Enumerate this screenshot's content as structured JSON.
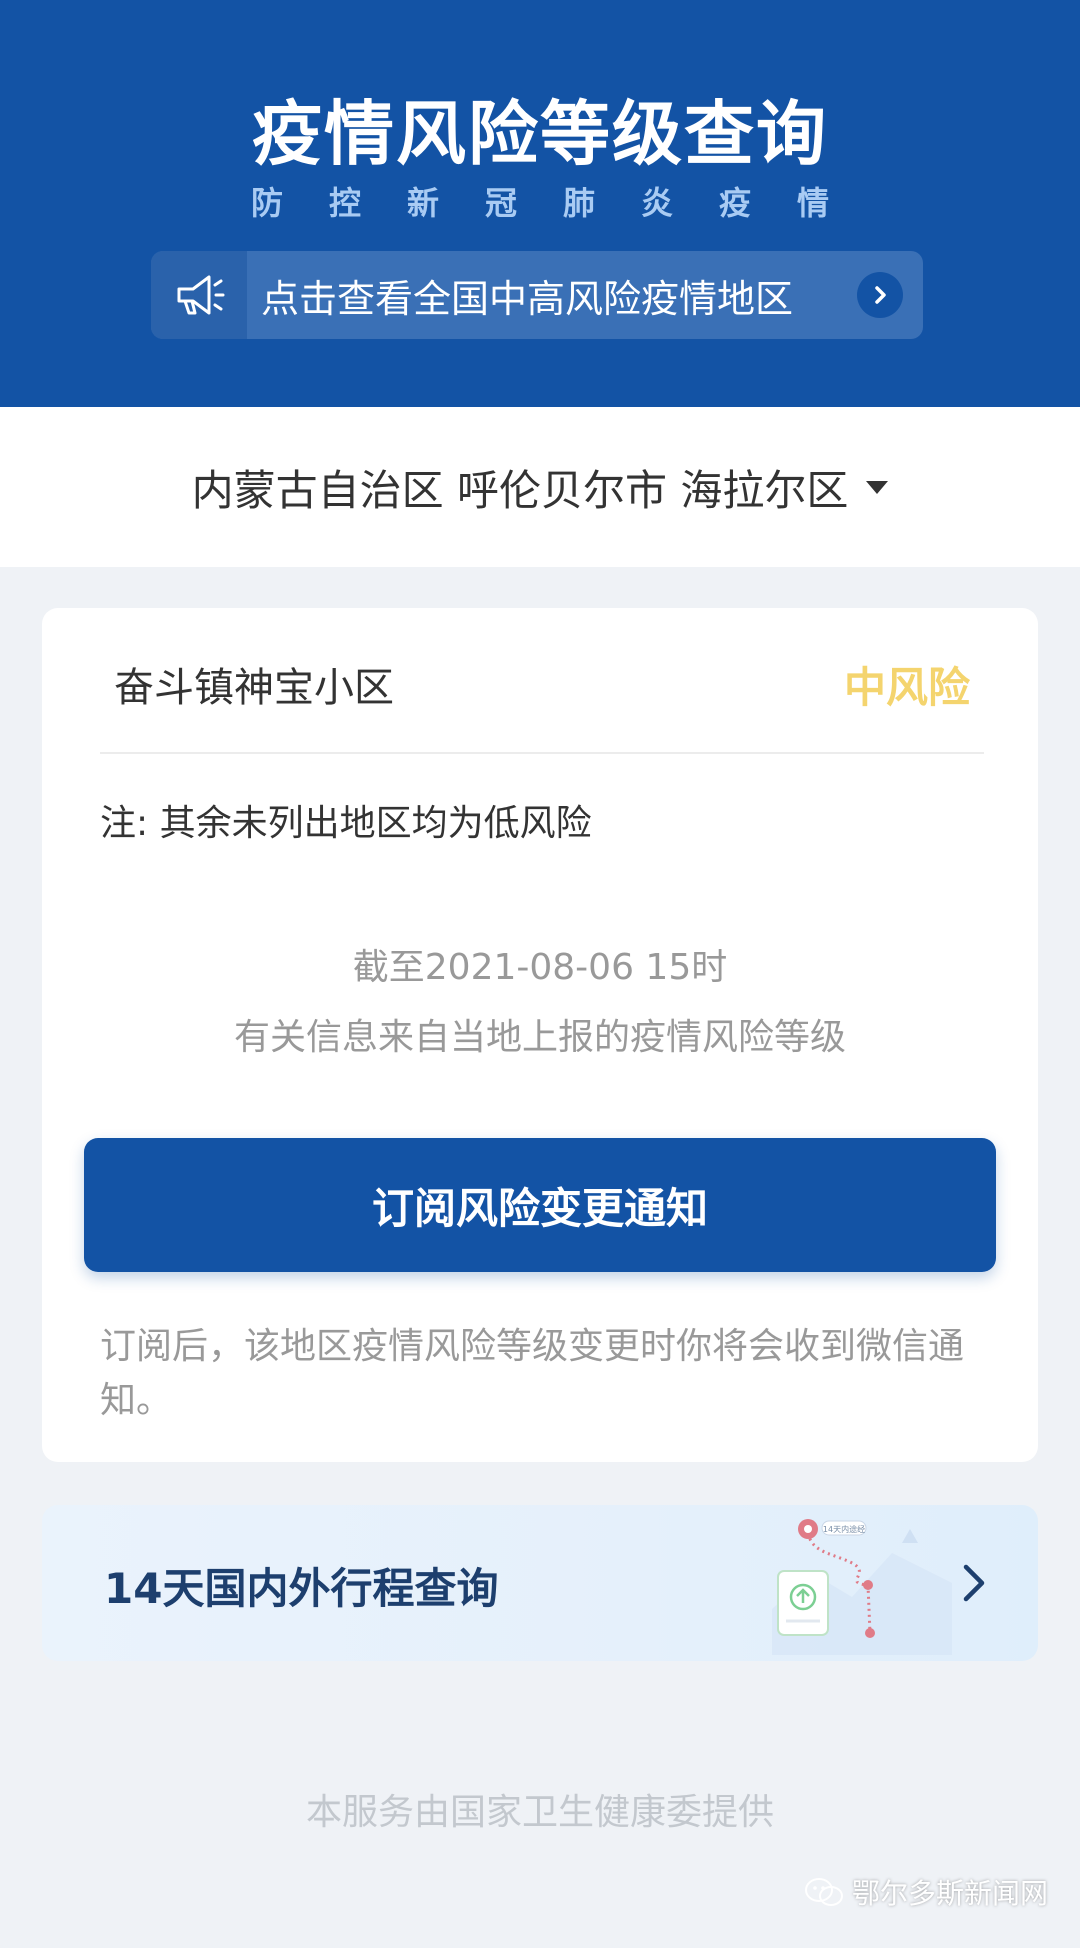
{
  "header": {
    "title": "疫情风险等级查询",
    "subtitle": "防控新冠肺炎疫情",
    "notice_text": "点击查看全国中高风险疫情地区",
    "notice_icon": "megaphone-icon",
    "background_color": "#1353a5"
  },
  "region_selector": {
    "region": "内蒙古自治区 呼伦贝尔市 海拉尔区",
    "icon": "caret-down-icon"
  },
  "risk_card": {
    "area_name": "奋斗镇神宝小区",
    "risk_level": "中风险",
    "risk_color": "#f4d46e",
    "note": "注: 其余未列出地区均为低风险",
    "as_of": "截至2021-08-06 15时",
    "source": "有关信息来自当地上报的疫情风险等级",
    "subscribe_button": "订阅风险变更通知",
    "subscribe_note": "订阅后，该地区疫情风险等级变更时你将会收到微信通知。"
  },
  "trip_card": {
    "label": "14天国内外行程查询",
    "illustration_label": "14天内途经"
  },
  "footer": {
    "text": "本服务由国家卫生健康委提供"
  },
  "watermark": {
    "text": "鄂尔多斯新闻网"
  }
}
